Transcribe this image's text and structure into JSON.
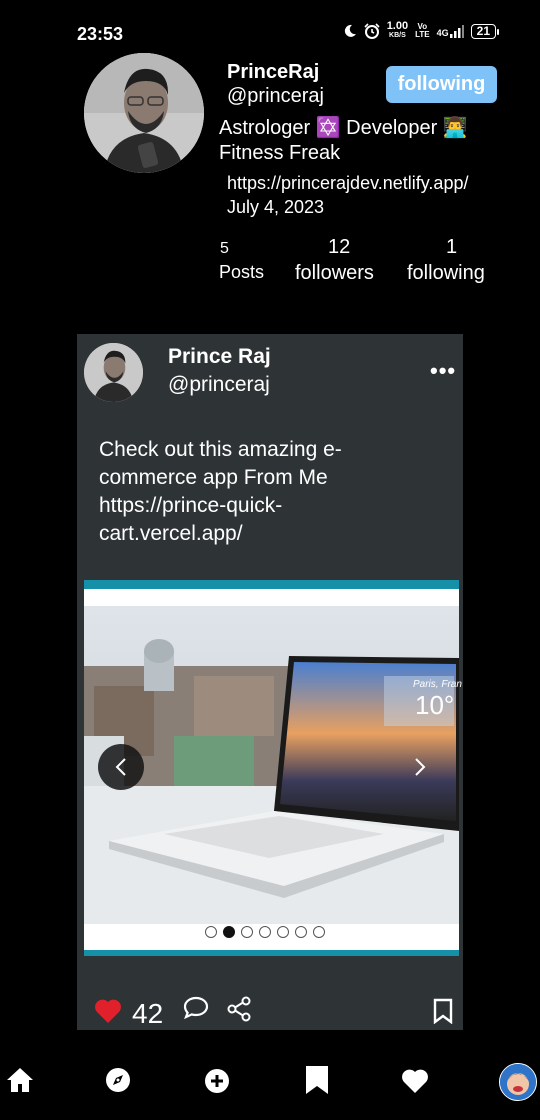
{
  "status_bar": {
    "time": "23:53",
    "speed": "1.00",
    "speed_unit": "KB/S",
    "net_top": "Vo",
    "net_bottom": "LTE",
    "signal": "4G",
    "battery": "21"
  },
  "profile": {
    "name": "PrinceRaj",
    "handle": "@princeraj",
    "follow_label": "following",
    "bio": "Astrologer ✡️ Developer 👨‍💻 Fitness Freak",
    "website": "https://princerajdev.netlify.app/",
    "joined": "July 4, 2023",
    "stats": {
      "posts_count": "5",
      "posts_label": "Posts",
      "followers_count": "12",
      "followers_label": "followers",
      "following_count": "1",
      "following_label": "following"
    }
  },
  "post": {
    "author": "Prince Raj",
    "handle": "@princeraj",
    "more_label": "•••",
    "text": "Check out this amazing e-commerce app From Me https://prince-quick-cart.vercel.app/",
    "image_caption": "Paris, Fran",
    "image_temp": "10°",
    "carousel": {
      "total": 7,
      "active_index": 1
    },
    "likes": "42"
  },
  "colors": {
    "accent": "#7ec2f7",
    "like": "#e0202b",
    "card": "#2e3336",
    "carousel_band": "#1590a8"
  },
  "icons": {
    "like": "heart-icon",
    "comment": "comment-icon",
    "share": "share-icon",
    "bookmark": "bookmark-icon",
    "home": "home-icon",
    "explore": "compass-icon",
    "create": "plus-circle-icon",
    "saved": "bookmark-filled-icon",
    "likes": "heart-outline-icon"
  }
}
